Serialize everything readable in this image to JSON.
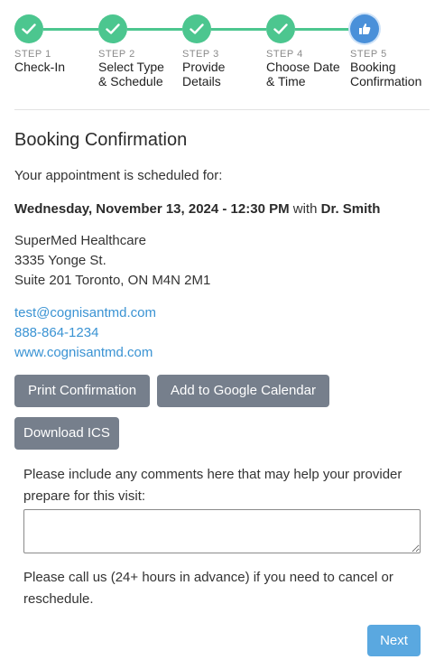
{
  "stepper": {
    "steps": [
      {
        "number": "STEP 1",
        "title": "Check-In",
        "status": "complete",
        "icon": "check-icon"
      },
      {
        "number": "STEP 2",
        "title": "Select Type & Schedule",
        "status": "complete",
        "icon": "check-icon"
      },
      {
        "number": "STEP 3",
        "title": "Provide Details",
        "status": "complete",
        "icon": "check-icon"
      },
      {
        "number": "STEP 4",
        "title": "Choose Date & Time",
        "status": "complete",
        "icon": "check-icon"
      },
      {
        "number": "STEP 5",
        "title": "Booking Confirmation",
        "status": "current",
        "icon": "thumbs-up-icon"
      }
    ],
    "colors": {
      "complete": "#4cc68f",
      "current": "#4a90d9"
    }
  },
  "confirmation": {
    "title": "Booking Confirmation",
    "intro": "Your appointment is scheduled for:",
    "datetime": "Wednesday, November 13, 2024 - 12:30 PM",
    "with_text": "with",
    "provider": "Dr. Smith"
  },
  "clinic": {
    "name": "SuperMed Healthcare",
    "address_line1": "3335 Yonge St.",
    "address_line2": "Suite 201 Toronto, ON M4N 2M1",
    "email": "test@cognisantmd.com",
    "phone": "888-864-1234",
    "website": "www.cognisantmd.com"
  },
  "actions": {
    "print_label": "Print Confirmation",
    "google_calendar_label": "Add to Google Calendar",
    "download_ics_label": "Download ICS"
  },
  "comments": {
    "label": "Please include any comments here that may help your provider prepare for this visit:",
    "value": ""
  },
  "cancel_note": "Please call us (24+ hours in advance) if you need to cancel or reschedule.",
  "next_label": "Next",
  "colors": {
    "link": "#3a93d3",
    "button": "#767f8c",
    "primary_button": "#5aa8e0"
  }
}
